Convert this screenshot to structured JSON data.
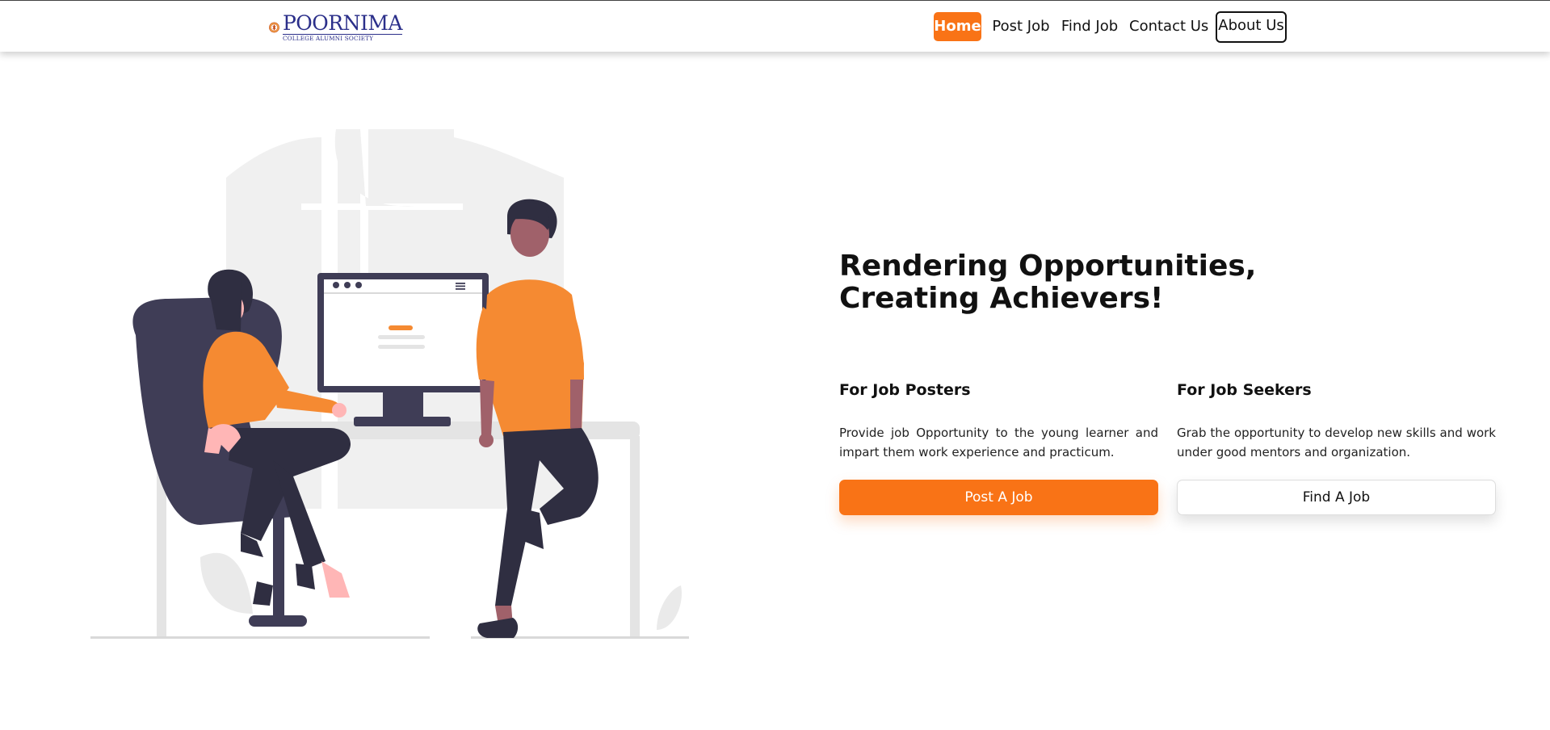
{
  "brand": {
    "logo_main": "POORNIMA",
    "logo_sub": "COLLEGE ALUMNI SOCIETY",
    "accent_color": "#f97316",
    "logo_color": "#2b2f8a"
  },
  "nav": {
    "home": "Home",
    "post_job": "Post Job",
    "find_job": "Find Job",
    "contact_us": "Contact Us",
    "about_us": "About Us"
  },
  "hero": {
    "title_line1": "Rendering Opportunities,",
    "title_line2": "Creating Achievers!"
  },
  "posters": {
    "heading": "For Job Posters",
    "text": "Provide job Opportunity to the young learner and impart them work experience and practicum.",
    "button": "Post A Job"
  },
  "seekers": {
    "heading": "For Job Seekers",
    "text": "Grab the opportunity to develop new skills and work under good mentors and organization.",
    "button": "Find A Job"
  },
  "illustration": {
    "icon": "office-people-illustration",
    "shirt_color": "#f58a32",
    "dark_color": "#3f3d56"
  }
}
